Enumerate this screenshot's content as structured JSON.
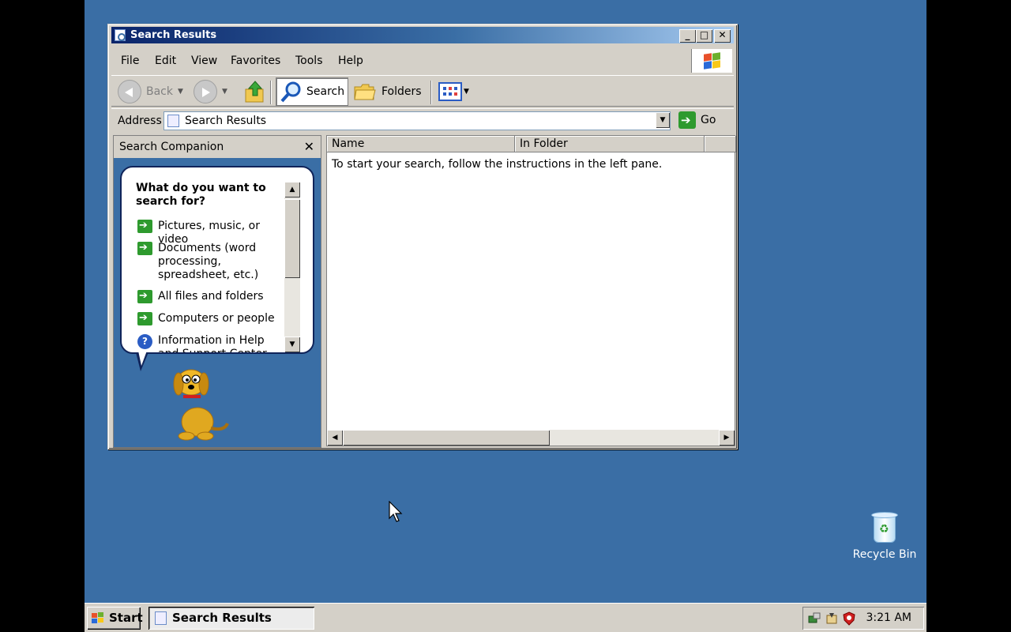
{
  "window": {
    "title": "Search Results",
    "menu": [
      "File",
      "Edit",
      "View",
      "Favorites",
      "Tools",
      "Help"
    ],
    "toolbar": {
      "back_label": "Back",
      "search_label": "Search",
      "folders_label": "Folders"
    },
    "address": {
      "label": "Address",
      "value": "Search Results",
      "go_label": "Go"
    }
  },
  "companion": {
    "title": "Search Companion",
    "question": "What do you want to search for?",
    "options": [
      "Pictures, music, or video",
      "Documents (word processing, spreadsheet, etc.)",
      "All files and folders",
      "Computers or people",
      "Information in Help and Support Center"
    ]
  },
  "results": {
    "columns": [
      "Name",
      "In Folder"
    ],
    "message": "To start your search, follow the instructions in the left pane."
  },
  "desktop": {
    "icons": [
      {
        "label": "Recycle Bin",
        "icon": "recycle-bin-icon"
      }
    ]
  },
  "taskbar": {
    "start_label": "Start",
    "task_label": "Search Results",
    "clock": "3:21 AM"
  },
  "colors": {
    "desktop": "#3a6ea5",
    "titlebar_start": "#0a246a",
    "titlebar_end": "#a6caf0",
    "window_face": "#d4d0c8",
    "link_arrow": "#2e9a2e"
  }
}
